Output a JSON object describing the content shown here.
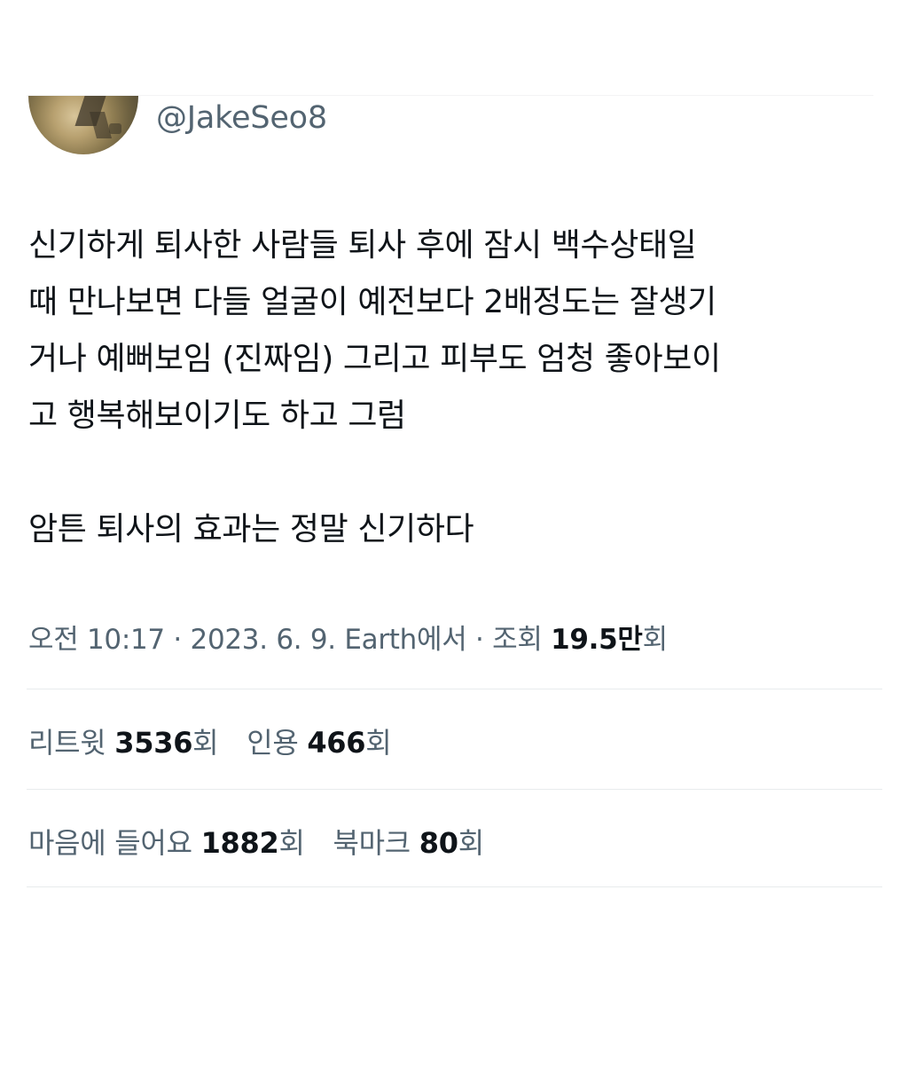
{
  "author": {
    "handle": "@JakeSeo8"
  },
  "tweet": {
    "lines": [
      "신기하게 퇴사한 사람들 퇴사 후에 잠시 백수상태일",
      "때 만나보면 다들 얼굴이 예전보다 2배정도는 잘생기",
      "거나 예뻐보임 (진짜임) 그리고 피부도 엄청 좋아보이",
      "고 행복해보이기도 하고 그럼",
      "",
      "암튼 퇴사의 효과는 정말 신기하다"
    ]
  },
  "meta": {
    "time": "오전 10:17",
    "dot1": " · ",
    "date": "2023. 6. 9.",
    "source": " Earth에서",
    "dot2": " · ",
    "views_label": "조회 ",
    "views_value": "19.5만",
    "views_unit": "회"
  },
  "stats": {
    "retweets_label": "리트윗 ",
    "retweets_value": "3536",
    "retweets_unit": "회",
    "quotes_label": "인용 ",
    "quotes_value": "466",
    "quotes_unit": "회",
    "likes_label": "마음에 들어요 ",
    "likes_value": "1882",
    "likes_unit": "회",
    "bookmarks_label": "북마크 ",
    "bookmarks_value": "80",
    "bookmarks_unit": "회"
  }
}
